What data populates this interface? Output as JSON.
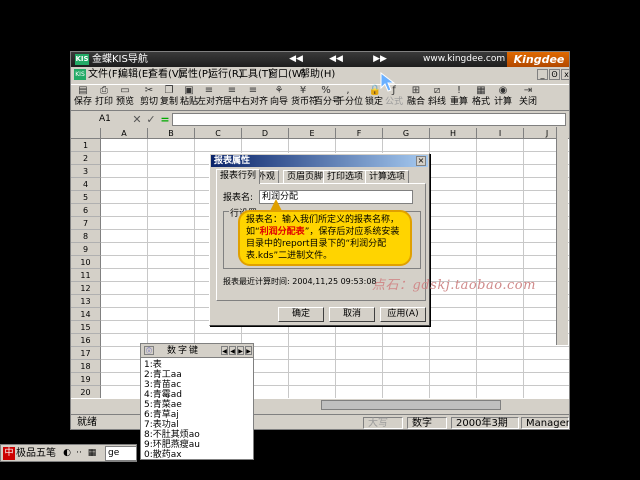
{
  "navbar": {
    "logo": "KIS",
    "title": "金蝶KIS导航",
    "prev": "◀◀",
    "back": "◀◀",
    "forward": "▶▶",
    "url": "www.kingdee.com",
    "brand": "Kingdee"
  },
  "menu": {
    "app_icon": "KIS",
    "items": [
      "文件(F)",
      "编辑(E)",
      "查看(V)",
      "属性(P)",
      "运行(R)",
      "工具(T)",
      "窗口(W)",
      "帮助(H)"
    ],
    "window_controls": [
      "_",
      "ʘ",
      "x"
    ]
  },
  "toolbar": {
    "buttons": [
      {
        "label": "保存",
        "icon": "save-icon",
        "enabled": true
      },
      {
        "label": "打印",
        "icon": "print-icon",
        "enabled": true
      },
      {
        "label": "预览",
        "icon": "preview-icon",
        "enabled": true
      },
      {
        "label": "剪切",
        "icon": "cut-icon",
        "enabled": true
      },
      {
        "label": "复制",
        "icon": "copy-icon",
        "enabled": true
      },
      {
        "label": "粘贴",
        "icon": "paste-icon",
        "enabled": true
      },
      {
        "label": "左对齐",
        "icon": "align-left-icon",
        "enabled": true
      },
      {
        "label": "居中",
        "icon": "align-center-icon",
        "enabled": true
      },
      {
        "label": "右对齐",
        "icon": "align-right-icon",
        "enabled": true
      },
      {
        "label": "向导",
        "icon": "wizard-icon",
        "enabled": true
      },
      {
        "label": "货币符",
        "icon": "currency-icon",
        "enabled": true
      },
      {
        "label": "百分号",
        "icon": "percent-icon",
        "enabled": true
      },
      {
        "label": "千分位",
        "icon": "thousands-icon",
        "enabled": true
      },
      {
        "label": "锁定",
        "icon": "lock-icon",
        "enabled": true
      },
      {
        "label": "公式",
        "icon": "formula-icon",
        "enabled": false
      },
      {
        "label": "融合",
        "icon": "merge-icon",
        "enabled": true
      },
      {
        "label": "斜线",
        "icon": "diagonal-icon",
        "enabled": true
      },
      {
        "label": "重算",
        "icon": "recalc-icon",
        "enabled": true
      },
      {
        "label": "格式",
        "icon": "format-icon",
        "enabled": true
      },
      {
        "label": "计算",
        "icon": "calc-icon",
        "enabled": true
      },
      {
        "label": "关闭",
        "icon": "close-icon",
        "enabled": true
      }
    ]
  },
  "formula": {
    "cell_ref": "A1",
    "cancel": "✕",
    "confirm": "✓",
    "equals": "="
  },
  "sheet": {
    "columns": [
      "A",
      "B",
      "C",
      "D",
      "E",
      "F",
      "G",
      "H",
      "I",
      "J"
    ],
    "rows": [
      "1",
      "2",
      "3",
      "4",
      "5",
      "6",
      "7",
      "8",
      "9",
      "10",
      "11",
      "12",
      "13",
      "14",
      "15",
      "16",
      "17",
      "18",
      "19",
      "20"
    ]
  },
  "dialog": {
    "title": "报表属性",
    "close": "×",
    "tabs": [
      "报表行列",
      "外观",
      "页眉页脚",
      "打印选项",
      "计算选项"
    ],
    "name_label": "报表名:",
    "name_value": "利润分配",
    "group_label": "行设置",
    "last_calc": "报表最近计算时间: 2004,11,25 09:53:08",
    "ok": "确定",
    "cancel": "取消",
    "apply": "应用(A)"
  },
  "callout": {
    "part1": "报表名：输入我们所定义的报表名称，如“",
    "highlight": "利润分配表",
    "part2": "”，保存后对应系统安装目录中的report目录下的“利润分配表.kds”二进制文件。"
  },
  "watermark": "点石：gdskj.taobao.com",
  "statusbar": {
    "ready": "就绪",
    "caps": "大写",
    "num": "数字",
    "period": "2000年3期",
    "user": "Manager"
  },
  "ime": {
    "title": "数字键",
    "nav": [
      "◀",
      "◀",
      "▶",
      "▶"
    ],
    "candidates": [
      "1:表",
      "2:青工aa",
      "3:青苗ac",
      "4:青霉ad",
      "5:青菜ae",
      "6:青草aj",
      "7:表功al",
      "8:不肚其烦ao",
      "9:环肥燕瘦au",
      "0:散药ax"
    ]
  },
  "imebar": {
    "lang": "中",
    "name": "极品五笔",
    "moon": "◐",
    "punct": "··",
    "kbd": "▦",
    "composition": "ge"
  }
}
